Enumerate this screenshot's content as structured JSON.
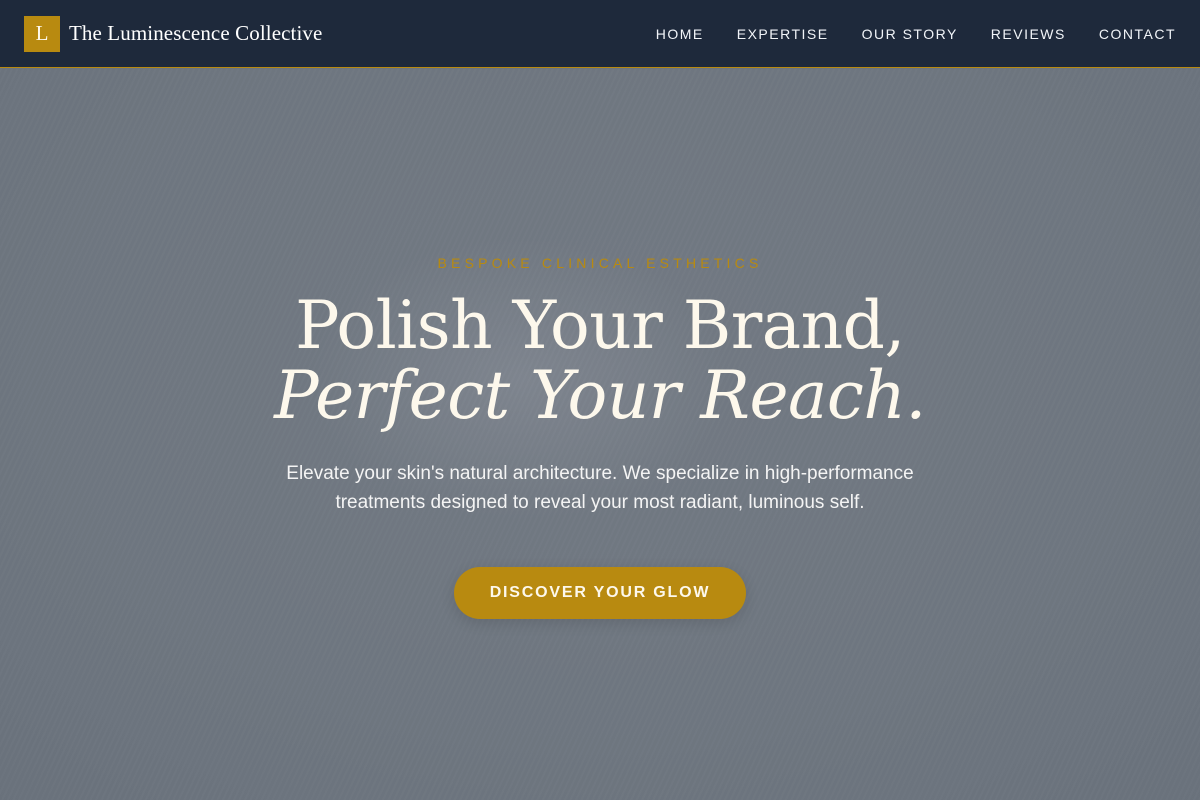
{
  "brand": {
    "mark": "L",
    "name": "The Luminescence Collective"
  },
  "nav": {
    "items": [
      {
        "label": "HOME"
      },
      {
        "label": "EXPERTISE"
      },
      {
        "label": "OUR STORY"
      },
      {
        "label": "REVIEWS"
      },
      {
        "label": "CONTACT"
      }
    ]
  },
  "hero": {
    "eyebrow": "BESPOKE CLINICAL ESTHETICS",
    "headline_line1": "Polish Your Brand,",
    "headline_line2": "Perfect Your Reach.",
    "subtext": "Elevate your skin's natural architecture. We specialize in high-performance treatments designed to reveal your most radiant, luminous self.",
    "cta_label": "DISCOVER YOUR GLOW"
  },
  "colors": {
    "nav_background": "#1e293b",
    "accent_gold": "#b88a10",
    "hero_background": "#6f7781",
    "headline_cream": "#fdf8ec"
  }
}
